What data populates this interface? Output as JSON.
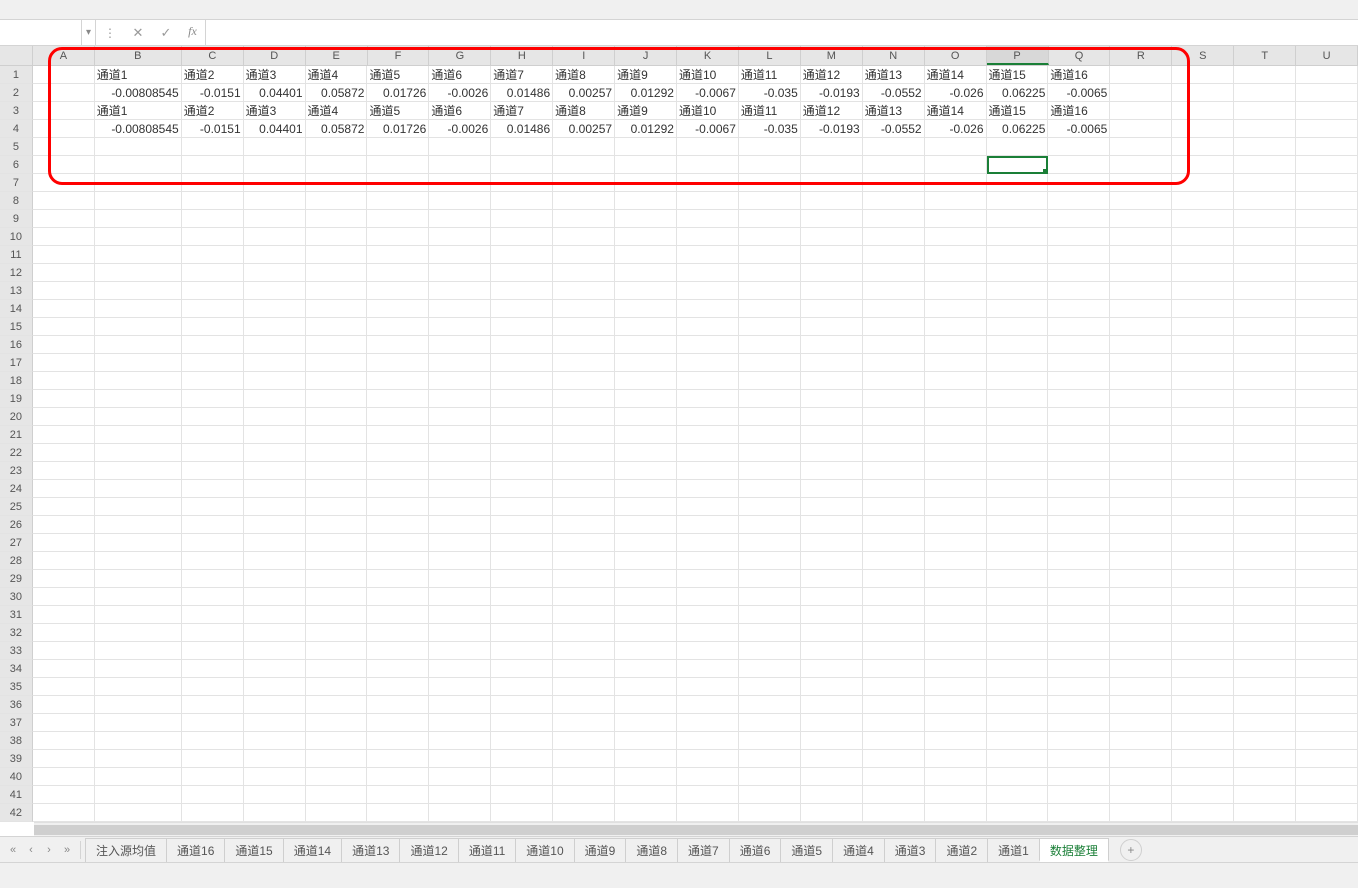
{
  "formula_bar": {
    "name_box": "",
    "fx": "fx",
    "formula": ""
  },
  "columns": [
    "A",
    "B",
    "C",
    "D",
    "E",
    "F",
    "G",
    "H",
    "I",
    "J",
    "K",
    "L",
    "M",
    "N",
    "O",
    "P",
    "Q",
    "R",
    "S",
    "T",
    "U"
  ],
  "col_widths": {
    "A": 34,
    "B": 90,
    "other": 64
  },
  "rows_count": 42,
  "active": {
    "col": "P",
    "row": 6
  },
  "selected_col_header": "P",
  "data_rows": [
    {
      "row": 1,
      "type": "text",
      "cells": {
        "B": "通道1",
        "C": "通道2",
        "D": "通道3",
        "E": "通道4",
        "F": "通道5",
        "G": "通道6",
        "H": "通道7",
        "I": "通道8",
        "J": "通道9",
        "K": "通道10",
        "L": "通道11",
        "M": "通道12",
        "N": "通道13",
        "O": "通道14",
        "P": "通道15",
        "Q": "通道16"
      }
    },
    {
      "row": 2,
      "type": "num",
      "cells": {
        "B": "-0.00808545",
        "C": "-0.0151",
        "D": "0.04401",
        "E": "0.05872",
        "F": "0.01726",
        "G": "-0.0026",
        "H": "0.01486",
        "I": "0.00257",
        "J": "0.01292",
        "K": "-0.0067",
        "L": "-0.035",
        "M": "-0.0193",
        "N": "-0.0552",
        "O": "-0.026",
        "P": "0.06225",
        "Q": "-0.0065"
      }
    },
    {
      "row": 3,
      "type": "text",
      "cells": {
        "B": "通道1",
        "C": "通道2",
        "D": "通道3",
        "E": "通道4",
        "F": "通道5",
        "G": "通道6",
        "H": "通道7",
        "I": "通道8",
        "J": "通道9",
        "K": "通道10",
        "L": "通道11",
        "M": "通道12",
        "N": "通道13",
        "O": "通道14",
        "P": "通道15",
        "Q": "通道16"
      }
    },
    {
      "row": 4,
      "type": "num",
      "cells": {
        "B": "-0.00808545",
        "C": "-0.0151",
        "D": "0.04401",
        "E": "0.05872",
        "F": "0.01726",
        "G": "-0.0026",
        "H": "0.01486",
        "I": "0.00257",
        "J": "0.01292",
        "K": "-0.0067",
        "L": "-0.035",
        "M": "-0.0193",
        "N": "-0.0552",
        "O": "-0.026",
        "P": "0.06225",
        "Q": "-0.0065"
      }
    }
  ],
  "sheet_tabs": [
    {
      "label": "注入源均值",
      "active": false
    },
    {
      "label": "通道16",
      "active": false
    },
    {
      "label": "通道15",
      "active": false
    },
    {
      "label": "通道14",
      "active": false
    },
    {
      "label": "通道13",
      "active": false
    },
    {
      "label": "通道12",
      "active": false
    },
    {
      "label": "通道11",
      "active": false
    },
    {
      "label": "通道10",
      "active": false
    },
    {
      "label": "通道9",
      "active": false
    },
    {
      "label": "通道8",
      "active": false
    },
    {
      "label": "通道7",
      "active": false
    },
    {
      "label": "通道6",
      "active": false
    },
    {
      "label": "通道5",
      "active": false
    },
    {
      "label": "通道4",
      "active": false
    },
    {
      "label": "通道3",
      "active": false
    },
    {
      "label": "通道2",
      "active": false
    },
    {
      "label": "通道1",
      "active": false
    },
    {
      "label": "数据整理",
      "active": true
    }
  ],
  "tab_nav": {
    "first": "«",
    "prev": "‹",
    "next": "›",
    "last": "»"
  },
  "buttons": {
    "cancel": "✕",
    "confirm": "✓",
    "dropdown": "▾",
    "add": "+"
  }
}
